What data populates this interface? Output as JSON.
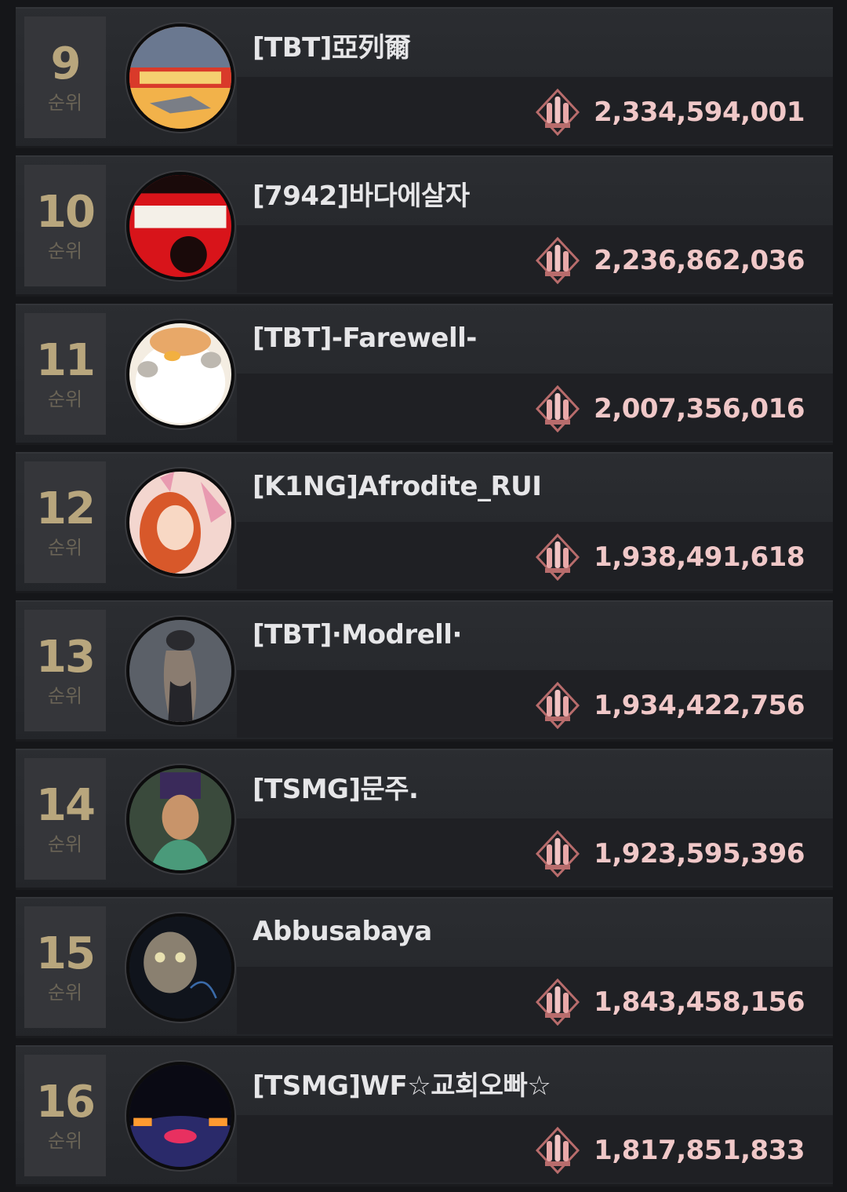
{
  "rank_label": "순위",
  "colors": {
    "rank_number": "#b8a67d",
    "score": "#f0c8c8",
    "ammo_icon": "#d98a8a"
  },
  "score_icon": "ammo-bullets-icon",
  "entries": [
    {
      "rank": "9",
      "name": "[TBT]亞列爾",
      "score": "2,334,594,001"
    },
    {
      "rank": "10",
      "name": "[7942]바다에살자",
      "score": "2,236,862,036"
    },
    {
      "rank": "11",
      "name": "[TBT]-Farewell-",
      "score": "2,007,356,016"
    },
    {
      "rank": "12",
      "name": "[K1NG]Afrodite_RUI",
      "score": "1,938,491,618"
    },
    {
      "rank": "13",
      "name": "[TBT]·Modrell·",
      "score": "1,934,422,756"
    },
    {
      "rank": "14",
      "name": "[TSMG]문주.",
      "score": "1,923,595,396"
    },
    {
      "rank": "15",
      "name": "Abbusabaya",
      "score": "1,843,458,156"
    },
    {
      "rank": "16",
      "name": "[TSMG]WF☆교회오빠☆",
      "score": "1,817,851,833"
    }
  ]
}
